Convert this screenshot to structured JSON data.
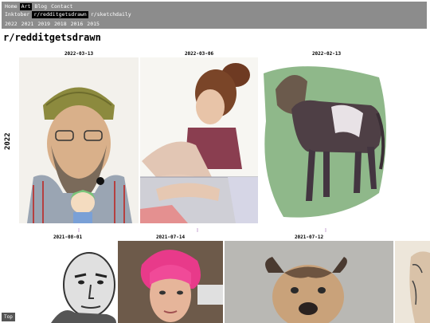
{
  "nav": {
    "row1": [
      "Home",
      "Art",
      "Blog",
      "Contact"
    ],
    "row1_active": "Art",
    "row2": [
      "Inktober",
      "r/redditgetsdrawn",
      "r/sketchdaily"
    ],
    "row2_active": "r/redditgetsdrawn",
    "years": [
      "2022",
      "2021",
      "2019",
      "2018",
      "2016",
      "2015"
    ]
  },
  "page": {
    "title": "r/redditgetsdrawn",
    "year_label": "2022",
    "top_button": "Top"
  },
  "row1": [
    {
      "date": "2022-03-13",
      "subject": "Bearded man in beanie with cartoon boy"
    },
    {
      "date": "2022-03-06",
      "subject": "Woman resting arm on knee"
    },
    {
      "date": "2022-02-13",
      "subject": "Pony on green background"
    }
  ],
  "row2": [
    {
      "date": "2021-08-01",
      "subject": "Bald man portrait"
    },
    {
      "date": "2021-07-14",
      "subject": "Woman with pink hair"
    },
    {
      "date": "2021-07-12",
      "subject": "Dog portrait"
    }
  ],
  "markers": [
    "▯",
    "▯",
    "▯"
  ]
}
